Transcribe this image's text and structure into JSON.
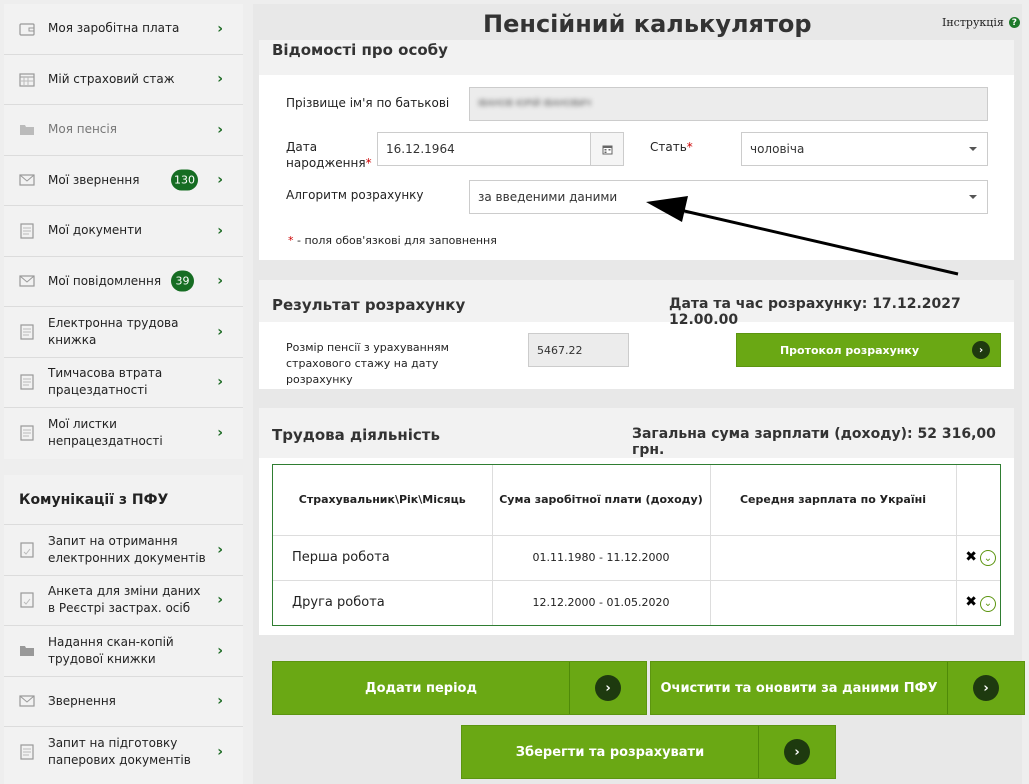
{
  "sidebar": {
    "items": [
      {
        "label": "Моя заробітна плата",
        "icon": "wallet-icon"
      },
      {
        "label": "Мій страховий стаж",
        "icon": "calendar-icon"
      },
      {
        "label": "Моя пенсія",
        "icon": "folder-icon"
      },
      {
        "label": "Мої звернення",
        "icon": "envelope-icon",
        "badge": "130"
      },
      {
        "label": "Мої документи",
        "icon": "document-icon"
      },
      {
        "label": "Мої повідомлення",
        "icon": "envelope-icon",
        "badge": "39"
      },
      {
        "label": "Електронна трудова книжка",
        "icon": "document-icon"
      },
      {
        "label": "Тимчасова втрата працездатності",
        "icon": "document-icon"
      },
      {
        "label": "Мої листки непрацездатності",
        "icon": "document-icon"
      }
    ],
    "comm_title": "Комунікації з ПФУ",
    "comm_items": [
      {
        "label": "Запит на отримання електронних документів",
        "icon": "document-icon"
      },
      {
        "label": "Анкета для зміни даних в Реєстрі застрах. осіб",
        "icon": "document-icon"
      },
      {
        "label": "Надання скан-копій трудової книжки",
        "icon": "folder-icon"
      },
      {
        "label": "Звернення",
        "icon": "envelope-icon"
      },
      {
        "label": "Запит на підготовку паперових документів",
        "icon": "document-icon"
      }
    ]
  },
  "header": {
    "title": "Пенсійний калькулятор",
    "help": "Інструкція"
  },
  "person": {
    "title": "Відомості про особу",
    "name_label": "Прізвище ім'я по батькові",
    "name_value": "ІВАНОВ ЮРІЙ ІВАНОВИЧ",
    "dob_label": "Дата народження",
    "dob_value": "16.12.1964",
    "sex_label": "Стать",
    "sex_value": "чоловіча",
    "algo_label": "Алгоритм розрахунку",
    "algo_value": "за введеними даними",
    "required_note": " - поля обов'язкові для заповнення",
    "asterisk": "*"
  },
  "result": {
    "title": "Результат розрахунку",
    "datetime": "Дата та час розрахунку: 17.12.2027 12.00.00",
    "pension_label": "Розмір пенсії з урахуванням страхового стажу на дату розрахунку",
    "pension_value": "5467.22",
    "protocol_button": "Протокол розрахунку"
  },
  "work": {
    "title": "Трудова діяльність",
    "total": "Загальна сума зарплати (доходу): 52 316,00 грн.",
    "columns": [
      "Страхувальник\\Рік\\Місяць",
      "Сума заробітної плати (доходу)",
      "Середня зарплата по Україні"
    ],
    "rows": [
      {
        "name": "Перша робота",
        "period": "01.11.1980 - 11.12.2000",
        "avg": ""
      },
      {
        "name": "Друга робота",
        "period": "12.12.2000 - 01.05.2020",
        "avg": ""
      }
    ]
  },
  "actions": {
    "add_period": "Додати період",
    "clear_update": "Очистити та оновити за даними ПФУ",
    "save_calc": "Зберегти та розрахувати"
  },
  "colors": {
    "accent_green": "#6aa814",
    "dark_green": "#166d23"
  }
}
